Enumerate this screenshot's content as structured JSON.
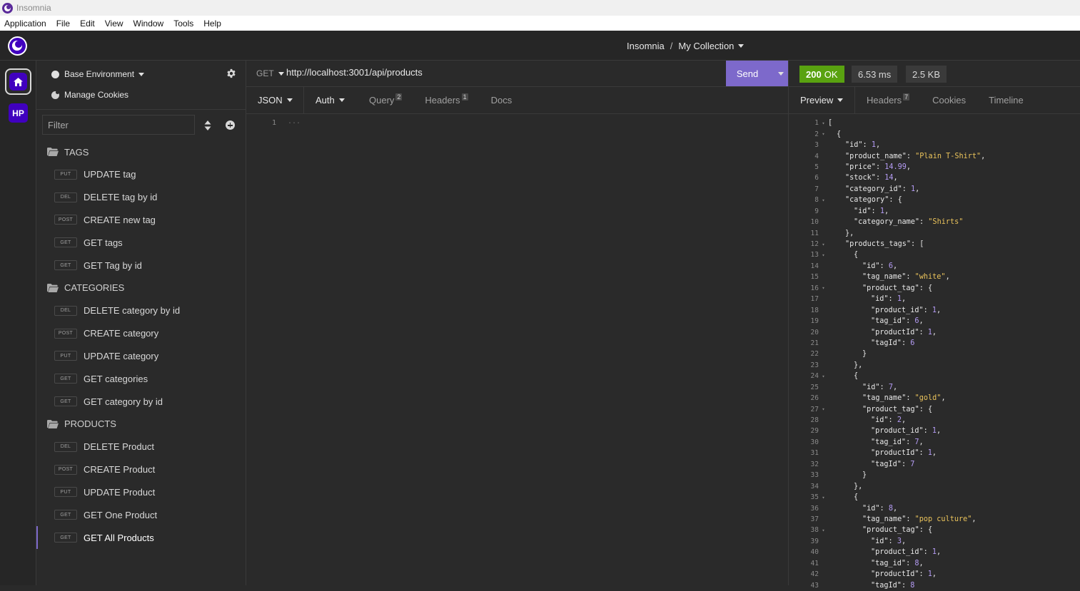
{
  "window": {
    "title": "Insomnia"
  },
  "menu": [
    "Application",
    "File",
    "Edit",
    "View",
    "Window",
    "Tools",
    "Help"
  ],
  "header": {
    "app": "Insomnia",
    "separator": "/",
    "collection": "My Collection"
  },
  "rail": {
    "hp_label": "HP"
  },
  "sidebar": {
    "environment": "Base Environment",
    "manage_cookies": "Manage Cookies",
    "filter_placeholder": "Filter",
    "folders": [
      {
        "name": "TAGS",
        "requests": [
          {
            "method": "PUT",
            "name": "UPDATE tag"
          },
          {
            "method": "DEL",
            "name": "DELETE tag by id"
          },
          {
            "method": "POST",
            "name": "CREATE new tag"
          },
          {
            "method": "GET",
            "name": "GET tags"
          },
          {
            "method": "GET",
            "name": "GET Tag by id"
          }
        ]
      },
      {
        "name": "CATEGORIES",
        "requests": [
          {
            "method": "DEL",
            "name": "DELETE category by id"
          },
          {
            "method": "POST",
            "name": "CREATE category"
          },
          {
            "method": "PUT",
            "name": "UPDATE category"
          },
          {
            "method": "GET",
            "name": "GET categories"
          },
          {
            "method": "GET",
            "name": "GET category by id"
          }
        ]
      },
      {
        "name": "PRODUCTS",
        "requests": [
          {
            "method": "DEL",
            "name": "DELETE Product"
          },
          {
            "method": "POST",
            "name": "CREATE Product"
          },
          {
            "method": "PUT",
            "name": "UPDATE Product"
          },
          {
            "method": "GET",
            "name": "GET One Product"
          },
          {
            "method": "GET",
            "name": "GET All Products",
            "active": true
          }
        ]
      }
    ]
  },
  "request": {
    "method": "GET",
    "url": "http://localhost:3001/api/products",
    "send_label": "Send",
    "tabs": {
      "body": "JSON",
      "auth": "Auth",
      "query": "Query",
      "query_count": "2",
      "headers": "Headers",
      "headers_count": "1",
      "docs": "Docs"
    },
    "editor": {
      "line": "1",
      "placeholder": "..."
    }
  },
  "response": {
    "status_code": "200",
    "status_text": "OK",
    "time": "6.53 ms",
    "size": "2.5 KB",
    "tabs": {
      "preview": "Preview",
      "headers": "Headers",
      "headers_count": "7",
      "cookies": "Cookies",
      "timeline": "Timeline"
    },
    "lines": [
      {
        "n": "1",
        "fold": true,
        "indent": 0,
        "parts": [
          [
            "p",
            "["
          ]
        ]
      },
      {
        "n": "2",
        "fold": true,
        "indent": 1,
        "parts": [
          [
            "p",
            "{"
          ]
        ]
      },
      {
        "n": "3",
        "indent": 2,
        "parts": [
          [
            "k",
            "\"id\""
          ],
          [
            "p",
            ": "
          ],
          [
            "num",
            "1"
          ],
          [
            "p",
            ","
          ]
        ]
      },
      {
        "n": "4",
        "indent": 2,
        "parts": [
          [
            "k",
            "\"product_name\""
          ],
          [
            "p",
            ": "
          ],
          [
            "s",
            "\"Plain T-Shirt\""
          ],
          [
            "p",
            ","
          ]
        ]
      },
      {
        "n": "5",
        "indent": 2,
        "parts": [
          [
            "k",
            "\"price\""
          ],
          [
            "p",
            ": "
          ],
          [
            "num",
            "14.99"
          ],
          [
            "p",
            ","
          ]
        ]
      },
      {
        "n": "6",
        "indent": 2,
        "parts": [
          [
            "k",
            "\"stock\""
          ],
          [
            "p",
            ": "
          ],
          [
            "num",
            "14"
          ],
          [
            "p",
            ","
          ]
        ]
      },
      {
        "n": "7",
        "indent": 2,
        "parts": [
          [
            "k",
            "\"category_id\""
          ],
          [
            "p",
            ": "
          ],
          [
            "num",
            "1"
          ],
          [
            "p",
            ","
          ]
        ]
      },
      {
        "n": "8",
        "fold": true,
        "indent": 2,
        "parts": [
          [
            "k",
            "\"category\""
          ],
          [
            "p",
            ": {"
          ]
        ]
      },
      {
        "n": "9",
        "indent": 3,
        "parts": [
          [
            "k",
            "\"id\""
          ],
          [
            "p",
            ": "
          ],
          [
            "num",
            "1"
          ],
          [
            "p",
            ","
          ]
        ]
      },
      {
        "n": "10",
        "indent": 3,
        "parts": [
          [
            "k",
            "\"category_name\""
          ],
          [
            "p",
            ": "
          ],
          [
            "s",
            "\"Shirts\""
          ]
        ]
      },
      {
        "n": "11",
        "indent": 2,
        "parts": [
          [
            "p",
            "},"
          ]
        ]
      },
      {
        "n": "12",
        "fold": true,
        "indent": 2,
        "parts": [
          [
            "k",
            "\"products_tags\""
          ],
          [
            "p",
            ": ["
          ]
        ]
      },
      {
        "n": "13",
        "fold": true,
        "indent": 3,
        "parts": [
          [
            "p",
            "{"
          ]
        ]
      },
      {
        "n": "14",
        "indent": 4,
        "parts": [
          [
            "k",
            "\"id\""
          ],
          [
            "p",
            ": "
          ],
          [
            "num",
            "6"
          ],
          [
            "p",
            ","
          ]
        ]
      },
      {
        "n": "15",
        "indent": 4,
        "parts": [
          [
            "k",
            "\"tag_name\""
          ],
          [
            "p",
            ": "
          ],
          [
            "s",
            "\"white\""
          ],
          [
            "p",
            ","
          ]
        ]
      },
      {
        "n": "16",
        "fold": true,
        "indent": 4,
        "parts": [
          [
            "k",
            "\"product_tag\""
          ],
          [
            "p",
            ": {"
          ]
        ]
      },
      {
        "n": "17",
        "indent": 5,
        "parts": [
          [
            "k",
            "\"id\""
          ],
          [
            "p",
            ": "
          ],
          [
            "num",
            "1"
          ],
          [
            "p",
            ","
          ]
        ]
      },
      {
        "n": "18",
        "indent": 5,
        "parts": [
          [
            "k",
            "\"product_id\""
          ],
          [
            "p",
            ": "
          ],
          [
            "num",
            "1"
          ],
          [
            "p",
            ","
          ]
        ]
      },
      {
        "n": "19",
        "indent": 5,
        "parts": [
          [
            "k",
            "\"tag_id\""
          ],
          [
            "p",
            ": "
          ],
          [
            "num",
            "6"
          ],
          [
            "p",
            ","
          ]
        ]
      },
      {
        "n": "20",
        "indent": 5,
        "parts": [
          [
            "k",
            "\"productId\""
          ],
          [
            "p",
            ": "
          ],
          [
            "num",
            "1"
          ],
          [
            "p",
            ","
          ]
        ]
      },
      {
        "n": "21",
        "indent": 5,
        "parts": [
          [
            "k",
            "\"tagId\""
          ],
          [
            "p",
            ": "
          ],
          [
            "num",
            "6"
          ]
        ]
      },
      {
        "n": "22",
        "indent": 4,
        "parts": [
          [
            "p",
            "}"
          ]
        ]
      },
      {
        "n": "23",
        "indent": 3,
        "parts": [
          [
            "p",
            "},"
          ]
        ]
      },
      {
        "n": "24",
        "fold": true,
        "indent": 3,
        "parts": [
          [
            "p",
            "{"
          ]
        ]
      },
      {
        "n": "25",
        "indent": 4,
        "parts": [
          [
            "k",
            "\"id\""
          ],
          [
            "p",
            ": "
          ],
          [
            "num",
            "7"
          ],
          [
            "p",
            ","
          ]
        ]
      },
      {
        "n": "26",
        "indent": 4,
        "parts": [
          [
            "k",
            "\"tag_name\""
          ],
          [
            "p",
            ": "
          ],
          [
            "s",
            "\"gold\""
          ],
          [
            "p",
            ","
          ]
        ]
      },
      {
        "n": "27",
        "fold": true,
        "indent": 4,
        "parts": [
          [
            "k",
            "\"product_tag\""
          ],
          [
            "p",
            ": {"
          ]
        ]
      },
      {
        "n": "28",
        "indent": 5,
        "parts": [
          [
            "k",
            "\"id\""
          ],
          [
            "p",
            ": "
          ],
          [
            "num",
            "2"
          ],
          [
            "p",
            ","
          ]
        ]
      },
      {
        "n": "29",
        "indent": 5,
        "parts": [
          [
            "k",
            "\"product_id\""
          ],
          [
            "p",
            ": "
          ],
          [
            "num",
            "1"
          ],
          [
            "p",
            ","
          ]
        ]
      },
      {
        "n": "30",
        "indent": 5,
        "parts": [
          [
            "k",
            "\"tag_id\""
          ],
          [
            "p",
            ": "
          ],
          [
            "num",
            "7"
          ],
          [
            "p",
            ","
          ]
        ]
      },
      {
        "n": "31",
        "indent": 5,
        "parts": [
          [
            "k",
            "\"productId\""
          ],
          [
            "p",
            ": "
          ],
          [
            "num",
            "1"
          ],
          [
            "p",
            ","
          ]
        ]
      },
      {
        "n": "32",
        "indent": 5,
        "parts": [
          [
            "k",
            "\"tagId\""
          ],
          [
            "p",
            ": "
          ],
          [
            "num",
            "7"
          ]
        ]
      },
      {
        "n": "33",
        "indent": 4,
        "parts": [
          [
            "p",
            "}"
          ]
        ]
      },
      {
        "n": "34",
        "indent": 3,
        "parts": [
          [
            "p",
            "},"
          ]
        ]
      },
      {
        "n": "35",
        "fold": true,
        "indent": 3,
        "parts": [
          [
            "p",
            "{"
          ]
        ]
      },
      {
        "n": "36",
        "indent": 4,
        "parts": [
          [
            "k",
            "\"id\""
          ],
          [
            "p",
            ": "
          ],
          [
            "num",
            "8"
          ],
          [
            "p",
            ","
          ]
        ]
      },
      {
        "n": "37",
        "indent": 4,
        "parts": [
          [
            "k",
            "\"tag_name\""
          ],
          [
            "p",
            ": "
          ],
          [
            "s",
            "\"pop culture\""
          ],
          [
            "p",
            ","
          ]
        ]
      },
      {
        "n": "38",
        "fold": true,
        "indent": 4,
        "parts": [
          [
            "k",
            "\"product_tag\""
          ],
          [
            "p",
            ": {"
          ]
        ]
      },
      {
        "n": "39",
        "indent": 5,
        "parts": [
          [
            "k",
            "\"id\""
          ],
          [
            "p",
            ": "
          ],
          [
            "num",
            "3"
          ],
          [
            "p",
            ","
          ]
        ]
      },
      {
        "n": "40",
        "indent": 5,
        "parts": [
          [
            "k",
            "\"product_id\""
          ],
          [
            "p",
            ": "
          ],
          [
            "num",
            "1"
          ],
          [
            "p",
            ","
          ]
        ]
      },
      {
        "n": "41",
        "indent": 5,
        "parts": [
          [
            "k",
            "\"tag_id\""
          ],
          [
            "p",
            ": "
          ],
          [
            "num",
            "8"
          ],
          [
            "p",
            ","
          ]
        ]
      },
      {
        "n": "42",
        "indent": 5,
        "parts": [
          [
            "k",
            "\"productId\""
          ],
          [
            "p",
            ": "
          ],
          [
            "num",
            "1"
          ],
          [
            "p",
            ","
          ]
        ]
      },
      {
        "n": "43",
        "indent": 5,
        "parts": [
          [
            "k",
            "\"tagId\""
          ],
          [
            "p",
            ": "
          ],
          [
            "num",
            "8"
          ]
        ]
      }
    ]
  },
  "colors": {
    "accent": "#7d69cb",
    "brand": "#4000bf",
    "status_ok": "#59a210",
    "json_string": "#eac35b",
    "json_number": "#b59cf5"
  }
}
